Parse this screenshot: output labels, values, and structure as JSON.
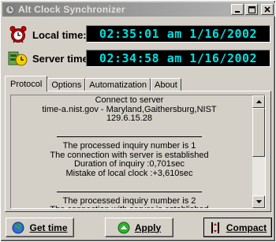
{
  "window": {
    "title": "Alt Clock Synchronizer"
  },
  "local_time": {
    "label": "Local time:",
    "value": "02:35:01 am  1/16/2002"
  },
  "server_time": {
    "label": "Server time:",
    "value": "02:34:58 am  1/16/2002"
  },
  "tabs": [
    "Protocol",
    "Options",
    "Automatization",
    "About"
  ],
  "log_lines": [
    "Connect to server",
    "time-a.nist.gov - Maryland,Gaithersburg,NIST",
    "129.6.15.28",
    "",
    "---",
    "The processed inquiry number is  1",
    "The connection with server is established",
    "Duration of inquiry :0,701sec",
    "Mistake of local clock :+3,610sec",
    "",
    "---",
    "The processed inquiry number is  2",
    "The connection with server is established"
  ],
  "buttons": {
    "get_time": "Get time",
    "apply": "Apply",
    "compact": "Compact"
  },
  "colors": {
    "lcd_text": "#00e0e0",
    "lcd_bg": "#000000"
  },
  "icons": {
    "local": "alarm-clock-icon",
    "server": "server-clock-icon"
  }
}
